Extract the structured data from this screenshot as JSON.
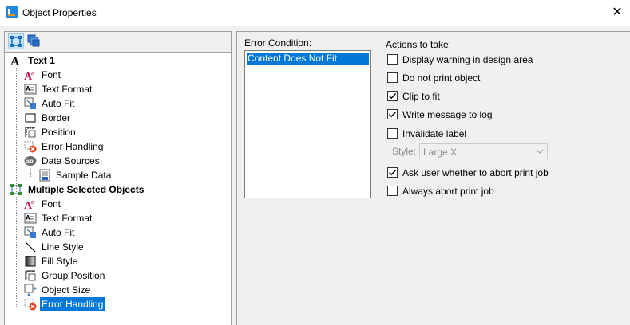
{
  "window": {
    "title": "Object Properties",
    "close_glyph": "✕"
  },
  "tree": {
    "items": [
      {
        "label": "Text 1"
      },
      {
        "label": "Font"
      },
      {
        "label": "Text Format"
      },
      {
        "label": "Auto Fit"
      },
      {
        "label": "Border"
      },
      {
        "label": "Position"
      },
      {
        "label": "Error Handling"
      },
      {
        "label": "Data Sources"
      },
      {
        "label": "Sample Data"
      },
      {
        "label": "Multiple Selected Objects"
      },
      {
        "label": "Font"
      },
      {
        "label": "Text Format"
      },
      {
        "label": "Auto Fit"
      },
      {
        "label": "Line Style"
      },
      {
        "label": "Fill Style"
      },
      {
        "label": "Group Position"
      },
      {
        "label": "Object Size"
      },
      {
        "label": "Error Handling"
      }
    ],
    "selected": "Error Handling"
  },
  "error_condition": {
    "label": "Error Condition:",
    "items": [
      "Content Does Not Fit"
    ],
    "selected": "Content Does Not Fit"
  },
  "actions": {
    "label": "Actions to take:",
    "options": [
      {
        "label": "Display warning in design area",
        "checked": false
      },
      {
        "label": "Do not print object",
        "checked": false
      },
      {
        "label": "Clip to fit",
        "checked": true
      },
      {
        "label": "Write message to log",
        "checked": true
      },
      {
        "label": "Invalidate label",
        "checked": false
      },
      {
        "label": "Ask user whether to abort print job",
        "checked": true
      },
      {
        "label": "Always abort print job",
        "checked": false
      }
    ],
    "style_label": "Style:",
    "style_value": "Large X",
    "style_enabled": false
  },
  "colors": {
    "selection": "#0078d7",
    "brand_blue": "#1e88e5",
    "brand_orange": "#f39c12"
  }
}
